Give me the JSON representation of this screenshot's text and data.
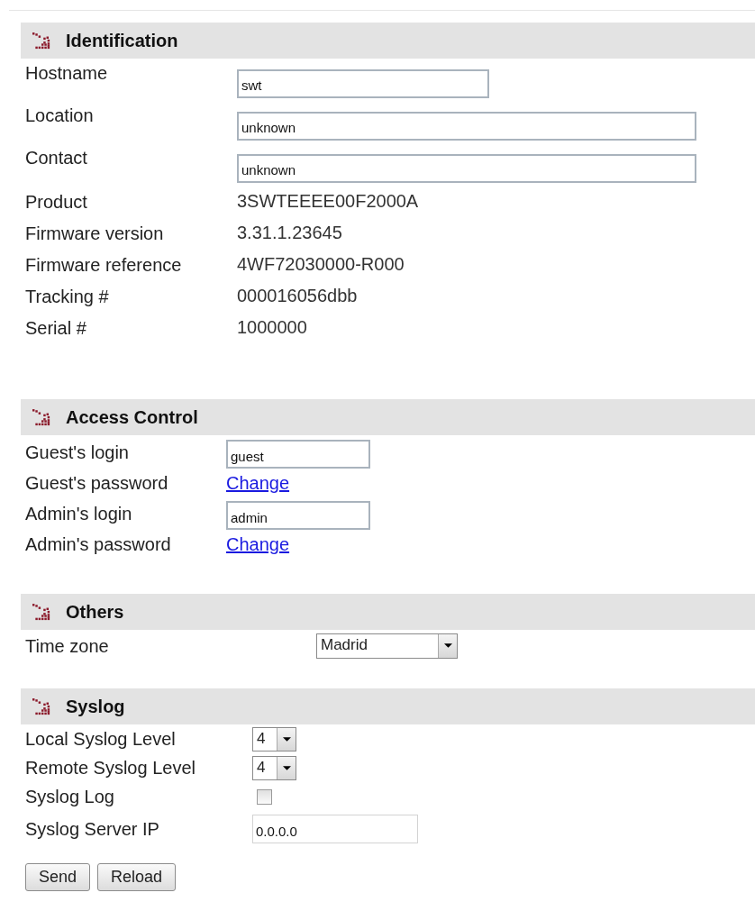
{
  "sections": [
    {
      "title": "Identification",
      "rows": [
        {
          "kind": "field",
          "label": "Hostname",
          "value": "swt"
        },
        {
          "kind": "wide-field",
          "label": "Location",
          "value": "unknown"
        },
        {
          "kind": "wide-field",
          "label": "Contact",
          "value": "unknown"
        },
        {
          "kind": "text",
          "label": "Product",
          "value": "3SWTEEEE00F2000A"
        },
        {
          "kind": "text",
          "label": "Firmware version",
          "value": "3.31.1.23645"
        },
        {
          "kind": "text",
          "label": "Firmware reference",
          "value": "4WF72030000-R000"
        },
        {
          "kind": "text",
          "label": "Tracking #",
          "value": "000016056dbb"
        },
        {
          "kind": "text",
          "label": "Serial #",
          "value": "1000000"
        }
      ]
    },
    {
      "title": "Access Control",
      "rows": [
        {
          "kind": "field",
          "label": "Guest's login",
          "value": "guest"
        },
        {
          "kind": "link",
          "label": "Guest's password",
          "value": "Change"
        },
        {
          "kind": "field",
          "label": "Admin's login",
          "value": "admin"
        },
        {
          "kind": "link",
          "label": "Admin's password",
          "value": "Change"
        }
      ]
    },
    {
      "title": "Others",
      "rows": [
        {
          "kind": "select",
          "label": "Time zone",
          "value": "Madrid"
        }
      ]
    },
    {
      "title": "Syslog",
      "rows": [
        {
          "kind": "small-select",
          "label": "Local Syslog Level",
          "value": "4"
        },
        {
          "kind": "small-select",
          "label": "Remote Syslog Level",
          "value": "4"
        },
        {
          "kind": "checkbox",
          "label": "Syslog Log",
          "checked": false
        },
        {
          "kind": "field",
          "label": "Syslog Server IP",
          "value": "0.0.0.0"
        }
      ]
    }
  ],
  "buttons": [
    "Send",
    "Reload"
  ]
}
